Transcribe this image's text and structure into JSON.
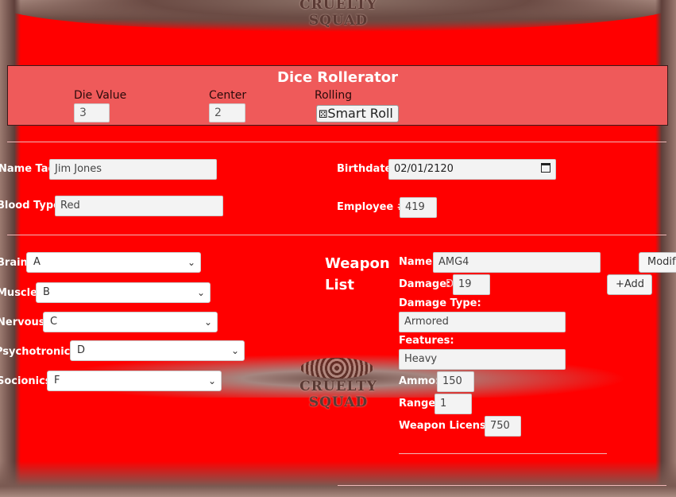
{
  "logo_text": "CRUELTY SQUAD",
  "dice": {
    "title": "Dice Rollerator",
    "die_value_label": "Die Value",
    "die_value": "3",
    "center_label": "Center",
    "center": "2",
    "rolling_label": "Rolling",
    "roll_button": "Smart Roll"
  },
  "profile": {
    "name_label": "Name Tag:",
    "name": "Jim Jones",
    "birthdate_label": "Birthdate:",
    "birthdate": "02/01/2120",
    "blood_label": "Blood Type:",
    "blood": "Red",
    "employee_label": "Employee #:",
    "employee": "419"
  },
  "stats": [
    {
      "label": "Brain:",
      "value": "A"
    },
    {
      "label": "Muscle:",
      "value": "B"
    },
    {
      "label": "Nervous:",
      "value": "C"
    },
    {
      "label": "Psychotronics:",
      "value": "D"
    },
    {
      "label": "Socionics:",
      "value": "F"
    }
  ],
  "weapon": {
    "title_line1": "Weapon",
    "title_line2": "List",
    "name_label": "Name:",
    "name": "AMG4",
    "modify_button": "Modify",
    "damage_label": "Damage:",
    "damage_prefix": "D",
    "damage": "19",
    "add_button": "+Add",
    "damage_type_label": "Damage Type:",
    "damage_type": "Armored",
    "features_label": "Features:",
    "features": "Heavy",
    "ammo_label": "Ammo:",
    "ammo": "150",
    "range_label": "Range:",
    "range": "1",
    "license_label": "Weapon License:",
    "license": "750"
  }
}
